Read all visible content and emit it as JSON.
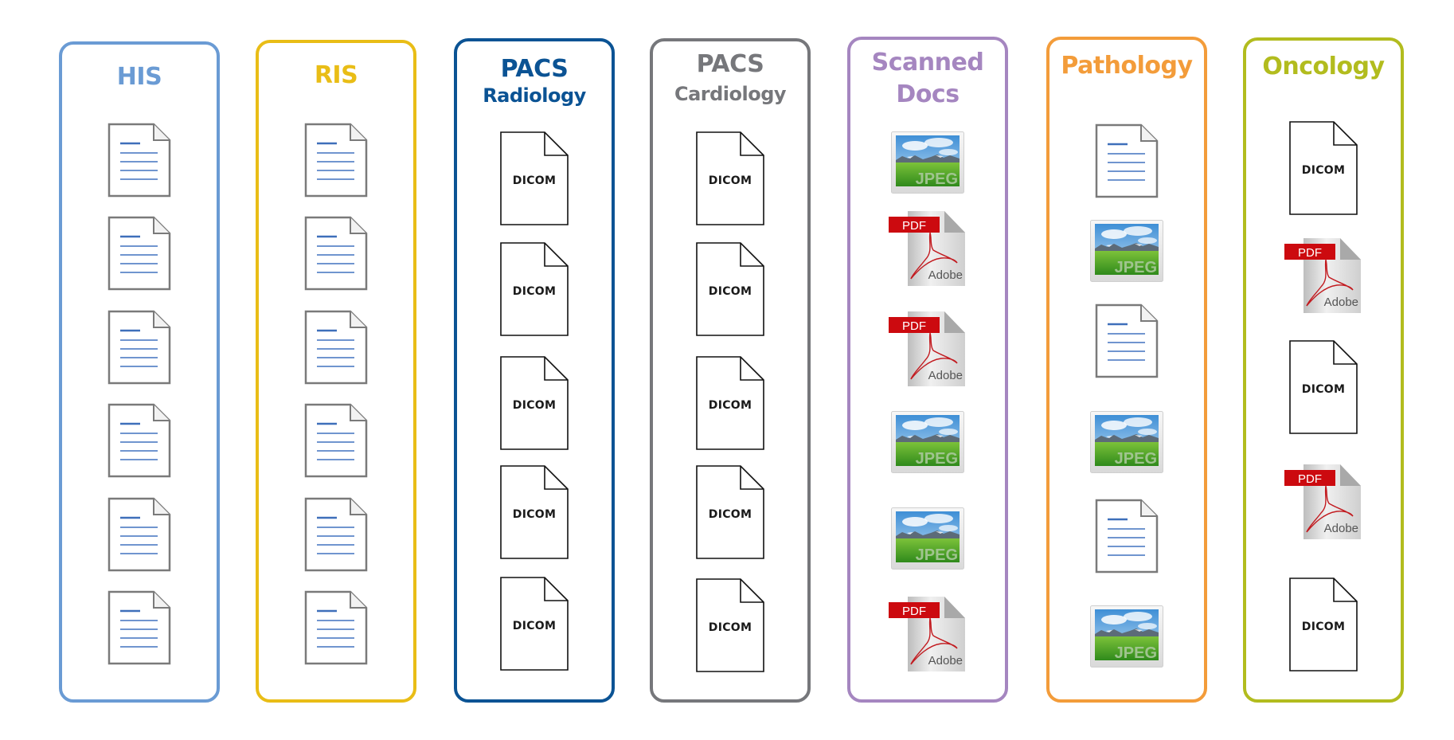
{
  "diagram": {
    "description": "Clinical data silos by department and file type",
    "columns": [
      {
        "id": "his",
        "title": "HIS",
        "subtitle": "",
        "color": "#6a9bd4",
        "items": [
          "document",
          "document",
          "document",
          "document",
          "document",
          "document"
        ]
      },
      {
        "id": "ris",
        "title": "RIS",
        "subtitle": "",
        "color": "#e9bd16",
        "items": [
          "document",
          "document",
          "document",
          "document",
          "document",
          "document"
        ]
      },
      {
        "id": "pacs-radiology",
        "title": "PACS",
        "subtitle": "Radiology",
        "color": "#0b5394",
        "items": [
          "dicom",
          "dicom",
          "dicom",
          "dicom",
          "dicom"
        ]
      },
      {
        "id": "pacs-cardiology",
        "title": "PACS",
        "subtitle": "Cardiology",
        "color": "#76777b",
        "items": [
          "dicom",
          "dicom",
          "dicom",
          "dicom",
          "dicom"
        ]
      },
      {
        "id": "scanned-docs",
        "title": "Scanned",
        "subtitle": "Docs",
        "color": "#a586c0",
        "items": [
          "jpeg",
          "pdf",
          "pdf",
          "jpeg",
          "jpeg",
          "pdf"
        ]
      },
      {
        "id": "pathology",
        "title": "Pathology",
        "subtitle": "",
        "color": "#f39c3a",
        "items": [
          "document",
          "jpeg",
          "document",
          "jpeg",
          "document",
          "jpeg"
        ]
      },
      {
        "id": "oncology",
        "title": "Oncology",
        "subtitle": "",
        "color": "#b2bc1e",
        "items": [
          "dicom",
          "pdf",
          "dicom",
          "pdf",
          "dicom"
        ]
      }
    ],
    "icon_labels": {
      "dicom": "DICOM",
      "jpeg": "JPEG",
      "pdf": "PDF",
      "adobe": "Adobe"
    },
    "icon_names": {
      "document": "text-document-icon",
      "dicom": "dicom-file-icon",
      "jpeg": "jpeg-image-icon",
      "pdf": "pdf-file-icon"
    }
  }
}
